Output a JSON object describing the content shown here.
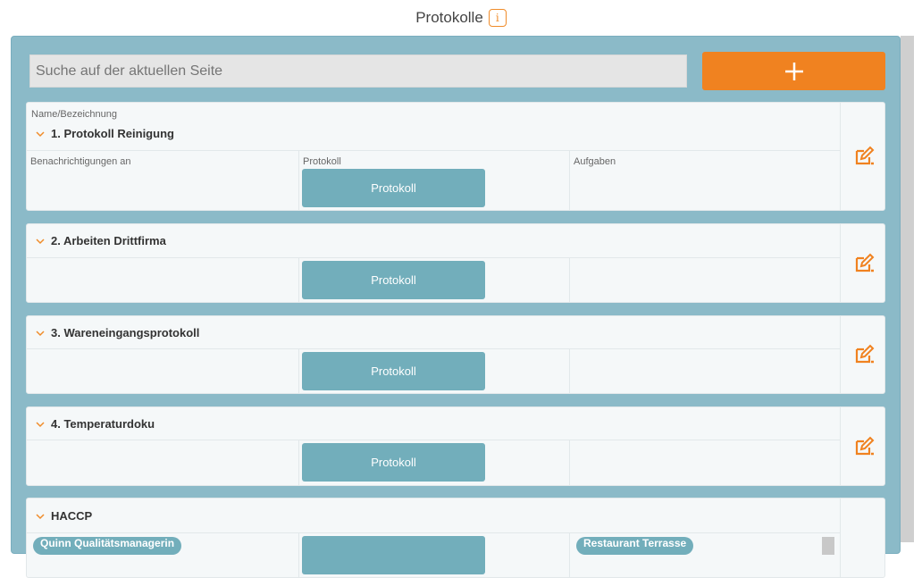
{
  "header": {
    "title": "Protokolle",
    "info_glyph": "i"
  },
  "search": {
    "placeholder": "Suche auf der aktuellen Seite",
    "value": ""
  },
  "add_button": {
    "icon": "plus-icon"
  },
  "columns": {
    "name": "Name/Bezeichnung",
    "notifications": "Benachrichtigungen an",
    "protocol": "Protokoll",
    "tasks": "Aufgaben"
  },
  "cards": [
    {
      "title": "1. Protokoll Reinigung",
      "button": "Protokoll"
    },
    {
      "title": "2. Arbeiten Drittfirma",
      "button": "Protokoll"
    },
    {
      "title": "3. Wareneingangsprotokoll",
      "button": "Protokoll"
    },
    {
      "title": "4. Temperaturdoku",
      "button": "Protokoll"
    },
    {
      "title": "HACCP",
      "pill_left": "Quinn Qualitätsmanagerin",
      "pill_right": "Restaurant Terrasse"
    }
  ],
  "colors": {
    "accent": "#f08220",
    "panel": "#8bbac8",
    "button": "#72aebb"
  }
}
